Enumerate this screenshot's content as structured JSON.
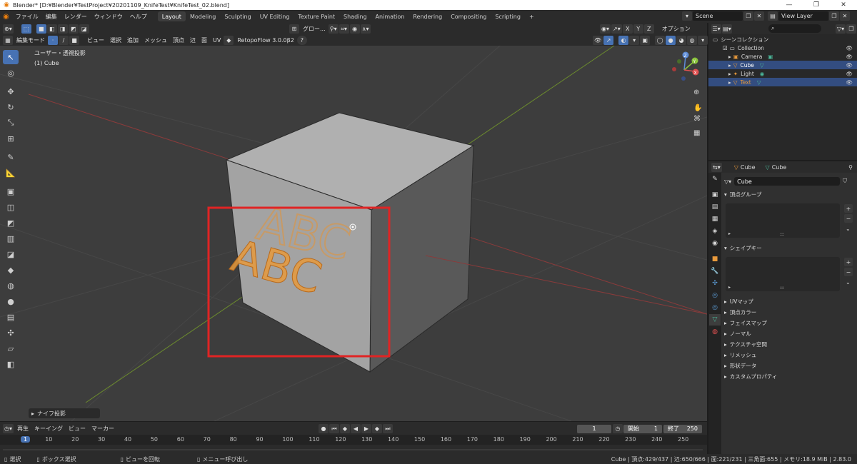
{
  "window": {
    "title": "Blender* [D:¥Blender¥TestProject¥20201109_KnifeTest¥KnifeTest_02.blend]",
    "controls": [
      "—",
      "❐",
      "✕"
    ]
  },
  "menubar": {
    "items": [
      "ファイル",
      "編集",
      "レンダー",
      "ウィンドウ",
      "ヘルプ"
    ],
    "workspaces": [
      "Layout",
      "Modeling",
      "Sculpting",
      "UV Editing",
      "Texture Paint",
      "Shading",
      "Animation",
      "Rendering",
      "Compositing",
      "Scripting"
    ],
    "active_workspace": "Layout",
    "add_tab": "+",
    "scene_label": "Scene",
    "view_layer_label": "View Layer"
  },
  "viewport_header": {
    "transform_orientation": "グロー...",
    "options_label": "オプション",
    "axis_x": "X",
    "axis_y": "Y",
    "axis_z": "Z"
  },
  "viewport_header2": {
    "mode": "編集モード",
    "menus": [
      "ビュー",
      "選択",
      "追加",
      "メッシュ",
      "頂点",
      "辺",
      "面",
      "UV"
    ],
    "addon": "RetopoFlow 3.0.0β2",
    "help": "?"
  },
  "viewport": {
    "view_name": "ユーザー・透視投影",
    "object_name": "(1) Cube",
    "operator_panel": "ナイフ投影",
    "text_front": "ABC",
    "text_back": "ABC",
    "gizmo_x": "X",
    "gizmo_y": "Y",
    "gizmo_z": "Z"
  },
  "timeline": {
    "menus": [
      "再生",
      "キーイング",
      "ビュー",
      "マーカー"
    ],
    "current_frame": "1",
    "start_label": "開始",
    "start_value": "1",
    "end_label": "終了",
    "end_value": "250",
    "ruler": [
      "1",
      "10",
      "20",
      "30",
      "40",
      "50",
      "60",
      "70",
      "80",
      "90",
      "100",
      "110",
      "120",
      "130",
      "140",
      "150",
      "160",
      "170",
      "180",
      "190",
      "200",
      "210",
      "220",
      "230",
      "240",
      "250"
    ]
  },
  "statusbar": {
    "items": [
      "選択",
      "ボックス選択",
      "ビューを回転",
      "メニュー呼び出し"
    ],
    "stats": "Cube | 頂点:429/437 | 辺:650/666 | 面:221/231 | 三角面:655 | メモリ:18.9 MiB | 2.83.0"
  },
  "outliner": {
    "root": "シーンコレクション",
    "collection": "Collection",
    "items": [
      {
        "name": "Camera",
        "selected": false
      },
      {
        "name": "Cube",
        "selected": true
      },
      {
        "name": "Light",
        "selected": false
      },
      {
        "name": "Text",
        "selected": true
      }
    ]
  },
  "properties": {
    "breadcrumb_object": "Cube",
    "breadcrumb_mesh": "Cube",
    "mesh_name": "Cube",
    "section_vgroups": "頂点グループ",
    "section_shapekeys": "シェイプキー",
    "sections": [
      "UVマップ",
      "頂点カラー",
      "フェイスマップ",
      "ノーマル",
      "テクスチャ空間",
      "リメッシュ",
      "形状データ",
      "カスタムプロパティ"
    ],
    "add": "+",
    "remove": "−"
  },
  "colors": {
    "accent": "#4772b3",
    "highlight_box": "#e02424",
    "text_orange": "#e89a3c",
    "cube_face": "#a3a3a3"
  }
}
